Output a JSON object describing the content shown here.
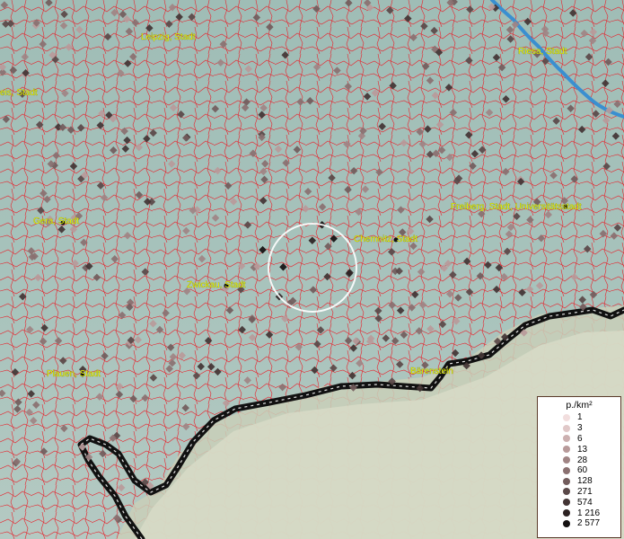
{
  "map": {
    "cities": [
      {
        "name": "Leipzig, Stadt"
      },
      {
        "name": "Riesa, Stadt"
      },
      {
        "name": "eis, Stadt"
      },
      {
        "name": "Gera, Stadt"
      },
      {
        "name": "Chemnitz, Stadt"
      },
      {
        "name": "Freiberg, Stadt, Universitätsstadt"
      },
      {
        "name": "Zwickau, Stadt"
      },
      {
        "name": "Plauen, Stadt"
      },
      {
        "name": "Bärenstein"
      }
    ],
    "colors": {
      "background": "#a9c2bb",
      "boundaries": "#e8202a",
      "river": "#3a8fd0",
      "border": "#111111",
      "label": "#e8f000",
      "highlight_circle": "#ffffff"
    }
  },
  "legend": {
    "title": "p./km²",
    "entries": [
      {
        "label": "1",
        "color": "#f2dede"
      },
      {
        "label": "3",
        "color": "#e0c8c8"
      },
      {
        "label": "6",
        "color": "#ccb0b0"
      },
      {
        "label": "13",
        "color": "#b89a9a"
      },
      {
        "label": "28",
        "color": "#a08484"
      },
      {
        "label": "60",
        "color": "#8a7070"
      },
      {
        "label": "128",
        "color": "#725c5c"
      },
      {
        "label": "271",
        "color": "#5a4848"
      },
      {
        "label": "574",
        "color": "#423434"
      },
      {
        "label": "1 216",
        "color": "#2c2222"
      },
      {
        "label": "2 577",
        "color": "#141010"
      }
    ]
  }
}
